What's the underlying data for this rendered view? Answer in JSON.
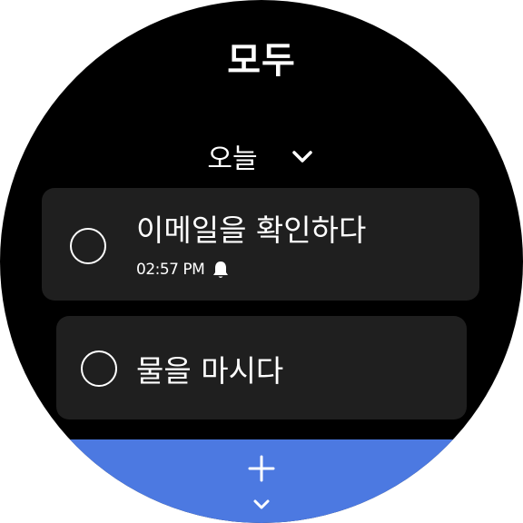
{
  "app": {
    "title": "모두"
  },
  "section": {
    "label": "오늘",
    "chevron_icon": "chevron-down-icon"
  },
  "tasks": [
    {
      "title": "이메일을 확인하다",
      "reminder_time": "02:57 PM",
      "reminder_icon": "bell-icon",
      "completed": false
    },
    {
      "title": "물을 마시다",
      "completed": false
    }
  ],
  "actions": {
    "add_icon": "plus-icon",
    "more_icon": "chevron-down-icon"
  },
  "colors": {
    "background": "#000000",
    "card": "#1f1f1f",
    "accent": "#4c79e1",
    "text": "#ffffff"
  }
}
